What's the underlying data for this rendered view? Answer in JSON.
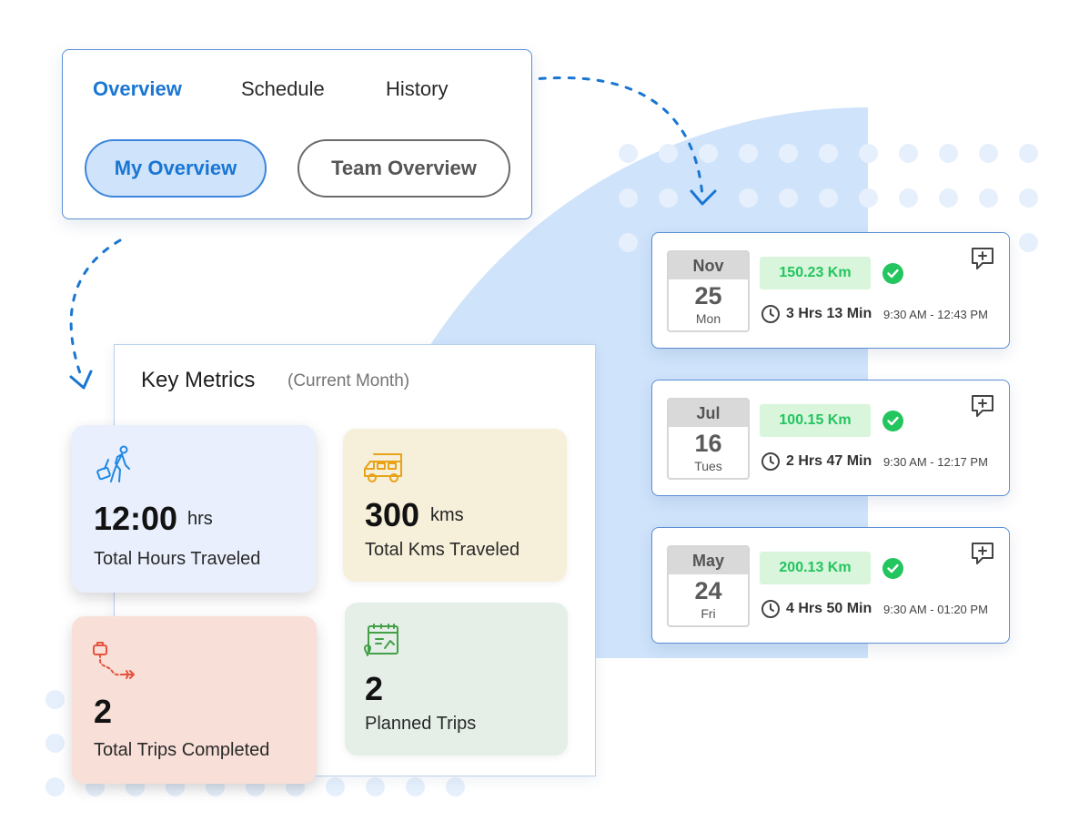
{
  "tabs": {
    "items": [
      {
        "label": "Overview",
        "active": true
      },
      {
        "label": "Schedule",
        "active": false
      },
      {
        "label": "History",
        "active": false
      }
    ],
    "view_toggle": {
      "primary": "My Overview",
      "secondary": "Team Overview"
    }
  },
  "metrics": {
    "title": "Key Metrics",
    "subtitle": "(Current Month)",
    "cards": [
      {
        "icon": "traveler-luggage-icon",
        "value": "12:00",
        "unit": "hrs",
        "label": "Total Hours Traveled"
      },
      {
        "icon": "camper-van-icon",
        "value": "300",
        "unit": "kms",
        "label": "Total Kms Traveled"
      },
      {
        "icon": "luggage-to-plane-route-icon",
        "value": "2",
        "unit": "",
        "label": "Total Trips Completed"
      },
      {
        "icon": "calendar-map-pin-icon",
        "value": "2",
        "unit": "",
        "label": "Planned Trips"
      }
    ]
  },
  "trips": [
    {
      "month": "Nov",
      "day": "25",
      "weekday": "Mon",
      "distance": "150.23 Km",
      "duration": "3 Hrs 13 Min",
      "time_range": "9:30 AM - 12:43 PM"
    },
    {
      "month": "Jul",
      "day": "16",
      "weekday": "Tues",
      "distance": "100.15 Km",
      "duration": "2 Hrs 47 Min",
      "time_range": "9:30 AM - 12:17 PM"
    },
    {
      "month": "May",
      "day": "24",
      "weekday": "Fri",
      "distance": "200.13 Km",
      "duration": "4 Hrs 50 Min",
      "time_range": "9:30 AM - 01:20 PM"
    }
  ],
  "colors": {
    "accent": "#1976d2",
    "success": "#22c55e",
    "success_bg": "#d9f5dc",
    "card_hours_bg": "#e9effc",
    "card_kms_bg": "#f6efd9",
    "card_trips_bg": "#f8dfd8",
    "card_planned_bg": "#e5efe8",
    "icon_blue": "#1e88e5",
    "icon_orange": "#e8a317",
    "icon_red": "#e5533d",
    "icon_green": "#43a047"
  }
}
